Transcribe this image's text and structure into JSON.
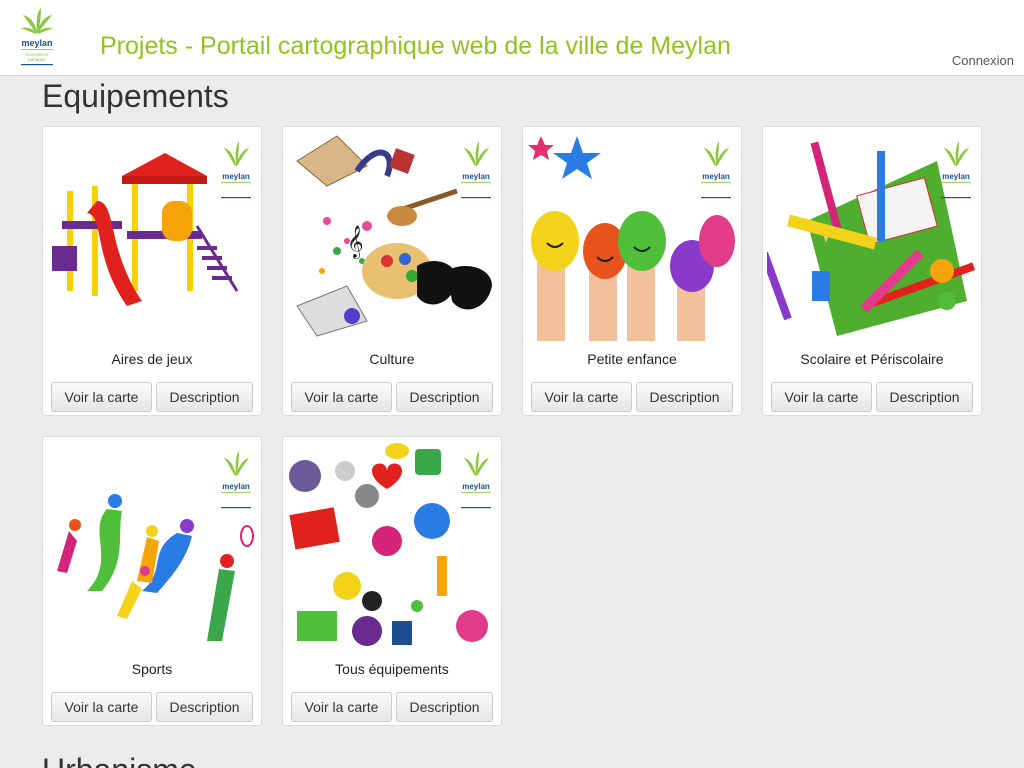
{
  "header": {
    "logo_text": "meylan",
    "logo_tagline": "l'excellence partagée",
    "title": "Projets - Portail cartographique web de la ville de Meylan",
    "login_label": "Connexion"
  },
  "section": {
    "title": "Equipements",
    "next_title": "Urbanisme"
  },
  "buttons": {
    "map_label": "Voir la carte",
    "description_label": "Description"
  },
  "cards": [
    {
      "name": "Aires de jeux",
      "image": "playground-image"
    },
    {
      "name": "Culture",
      "image": "culture-image"
    },
    {
      "name": "Petite enfance",
      "image": "painted-hands-image"
    },
    {
      "name": "Scolaire et Périscolaire",
      "image": "school-supplies-image"
    },
    {
      "name": "Sports",
      "image": "sports-silhouettes-image"
    },
    {
      "name": "Tous équipements",
      "image": "all-equipment-collage-image"
    }
  ],
  "colors": {
    "brand_green": "#95c11f",
    "logo_leaf": "#8dc63f",
    "logo_text": "#1d4f91"
  }
}
